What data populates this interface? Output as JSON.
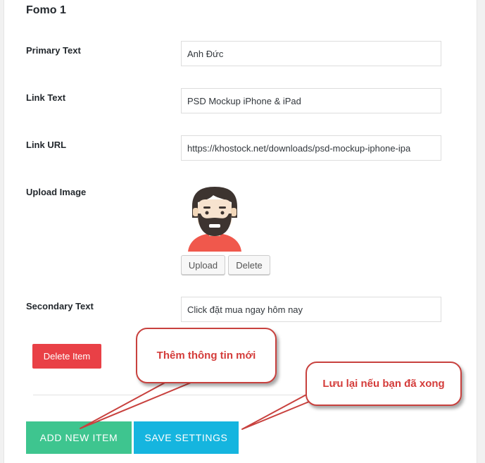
{
  "section": {
    "title": "Fomo 1"
  },
  "fields": {
    "primary_text": {
      "label": "Primary Text",
      "value": "Anh Đức"
    },
    "link_text": {
      "label": "Link Text",
      "value": "PSD Mockup iPhone & iPad"
    },
    "link_url": {
      "label": "Link URL",
      "value": "https://khostock.net/downloads/psd-mockup-iphone-ipa"
    },
    "upload_image": {
      "label": "Upload Image",
      "upload_label": "Upload",
      "delete_label": "Delete"
    },
    "secondary_text": {
      "label": "Secondary Text",
      "value": "Click đặt mua ngay hôm nay"
    }
  },
  "buttons": {
    "delete_item": "Delete Item",
    "add_new_item": "ADD NEW ITEM",
    "save_settings": "SAVE SETTINGS"
  },
  "annotations": {
    "callout_add": "Thêm thông tin mới",
    "callout_save": "Lưu lại nếu bạn đã xong"
  },
  "colors": {
    "delete_red": "#e94046",
    "add_green": "#3ec58f",
    "save_blue": "#15b5df",
    "callout_red": "#d43c3a"
  },
  "icons": {
    "avatar": "bearded-man-avatar-icon"
  }
}
